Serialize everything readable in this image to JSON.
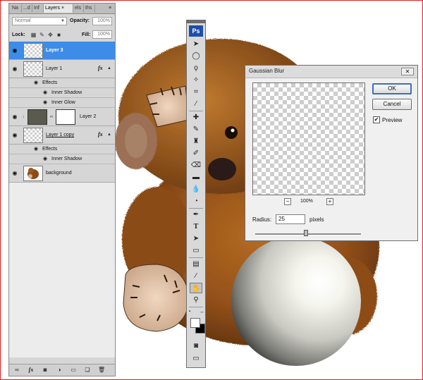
{
  "layers_panel": {
    "tabs": [
      {
        "label": "Na",
        "close": ""
      },
      {
        "label": "...d",
        "close": ""
      },
      {
        "label": "Inf",
        "close": ""
      },
      {
        "label": "Layers",
        "close": "×"
      },
      {
        "label": "els",
        "close": ""
      },
      {
        "label": "ths",
        "close": ""
      }
    ],
    "menu_icon": "panel-menu-icon",
    "blend_mode": "Normal",
    "opacity_label": "Opacity:",
    "opacity_value": "100%",
    "lock_label": "Lock:",
    "fill_label": "Fill:",
    "fill_value": "100%",
    "layers": [
      {
        "name": "Layer 3",
        "selected": true
      },
      {
        "name": "Layer 1",
        "fx": "fx",
        "effects_label": "Effects",
        "effects": [
          "Inner Shadow",
          "Inner Glow"
        ]
      },
      {
        "name": "Layer 2"
      },
      {
        "name": "Layer 1 copy",
        "fx": "fx",
        "effects_label": "Effects",
        "effects": [
          "Inner Shadow"
        ]
      },
      {
        "name": "background"
      }
    ],
    "bottom_icons": [
      "link-icon",
      "fx-icon",
      "mask-icon",
      "adjustment-icon",
      "group-icon",
      "new-layer-icon",
      "trash-icon"
    ],
    "bottom_fx": "fx"
  },
  "tools": {
    "logo": "Ps"
  },
  "dialog": {
    "title": "Gaussian Blur",
    "close": "✕",
    "ok": "OK",
    "cancel": "Cancel",
    "preview_label": "Preview",
    "preview_checked": true,
    "zoom_out": "−",
    "zoom_in": "+",
    "zoom": "100%",
    "radius_label": "Radius:",
    "radius_value": "25",
    "radius_unit": "pixels",
    "slider_level": 0.48
  },
  "colors": {
    "selected_layer": "#3d8ce8",
    "ps_logo": "#1e4ea8",
    "frame_border": "#e02020"
  }
}
